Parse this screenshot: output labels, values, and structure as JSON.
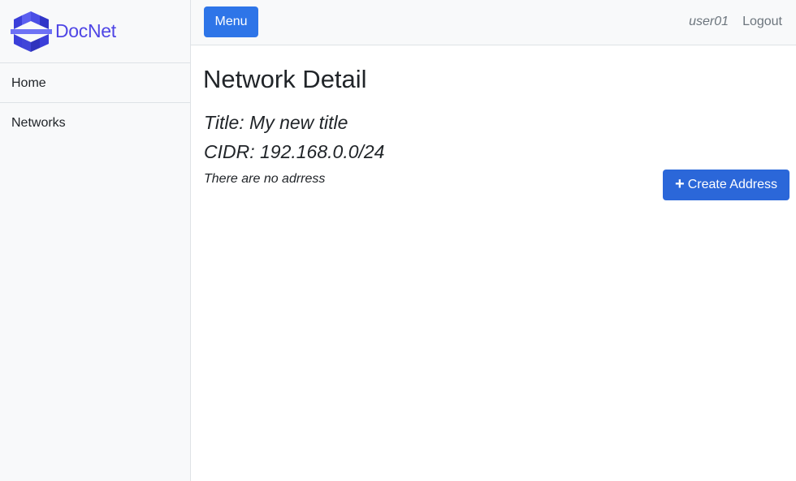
{
  "brand": {
    "name": "DocNet",
    "logo_icon": "layers-cube-logo",
    "color": "#4f46e5"
  },
  "sidebar": {
    "items": [
      {
        "label": "Home"
      },
      {
        "label": "Networks"
      }
    ]
  },
  "topbar": {
    "menu_label": "Menu",
    "username": "user01",
    "logout_label": "Logout"
  },
  "main": {
    "heading": "Network Detail",
    "title_line": "Title: My new title",
    "cidr_line": "CIDR: 192.168.0.0/24",
    "empty_message": "There are no adrress",
    "create_button_label": "Create Address",
    "create_button_icon": "plus-icon"
  },
  "colors": {
    "primary_button": "#2e75e8",
    "create_button": "#2b67d9",
    "sidebar_bg": "#f8f9fa"
  }
}
